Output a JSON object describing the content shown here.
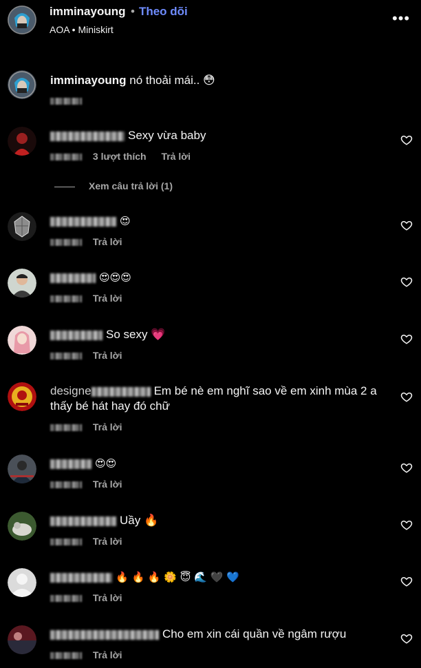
{
  "header": {
    "username": "imminayoung",
    "separator": "•",
    "follow_label": "Theo dõi",
    "subtitle": "AOA • Miniskirt",
    "more_label": "•••"
  },
  "caption": {
    "username": "imminayoung",
    "text": "nó thoải mái.. 😳"
  },
  "comments": [
    {
      "text": "Sexy vừa baby",
      "likes": "3 lượt thích",
      "reply": "Trả lời",
      "view_replies": "Xem câu trả lời (1)"
    },
    {
      "text": "😍",
      "reply": "Trả lời"
    },
    {
      "text": "😍😍😍",
      "reply": "Trả lời"
    },
    {
      "text": "So sexy 💗",
      "reply": "Trả lời"
    },
    {
      "text": "Em bé nè em nghĩ sao về em xinh mùa 2 a thấy bé hát hay đó chữ",
      "name_visible": "designe",
      "reply": "Trả lời"
    },
    {
      "text": "😍😍",
      "reply": "Trả lời"
    },
    {
      "text": "Uầy 🔥",
      "reply": "Trả lời"
    },
    {
      "text": "🔥 🔥 🔥 🌼 😇 🌊 🖤 💙",
      "reply": "Trả lời"
    },
    {
      "text": "Cho em xin cái quần về ngâm rượu",
      "reply": "Trả lời"
    }
  ],
  "colors": {
    "accent": "#6f8cff",
    "background": "#000000",
    "muted": "#a8a8a8"
  },
  "icons": {
    "like": "heart-outline-icon",
    "more": "more-horizontal-icon"
  }
}
